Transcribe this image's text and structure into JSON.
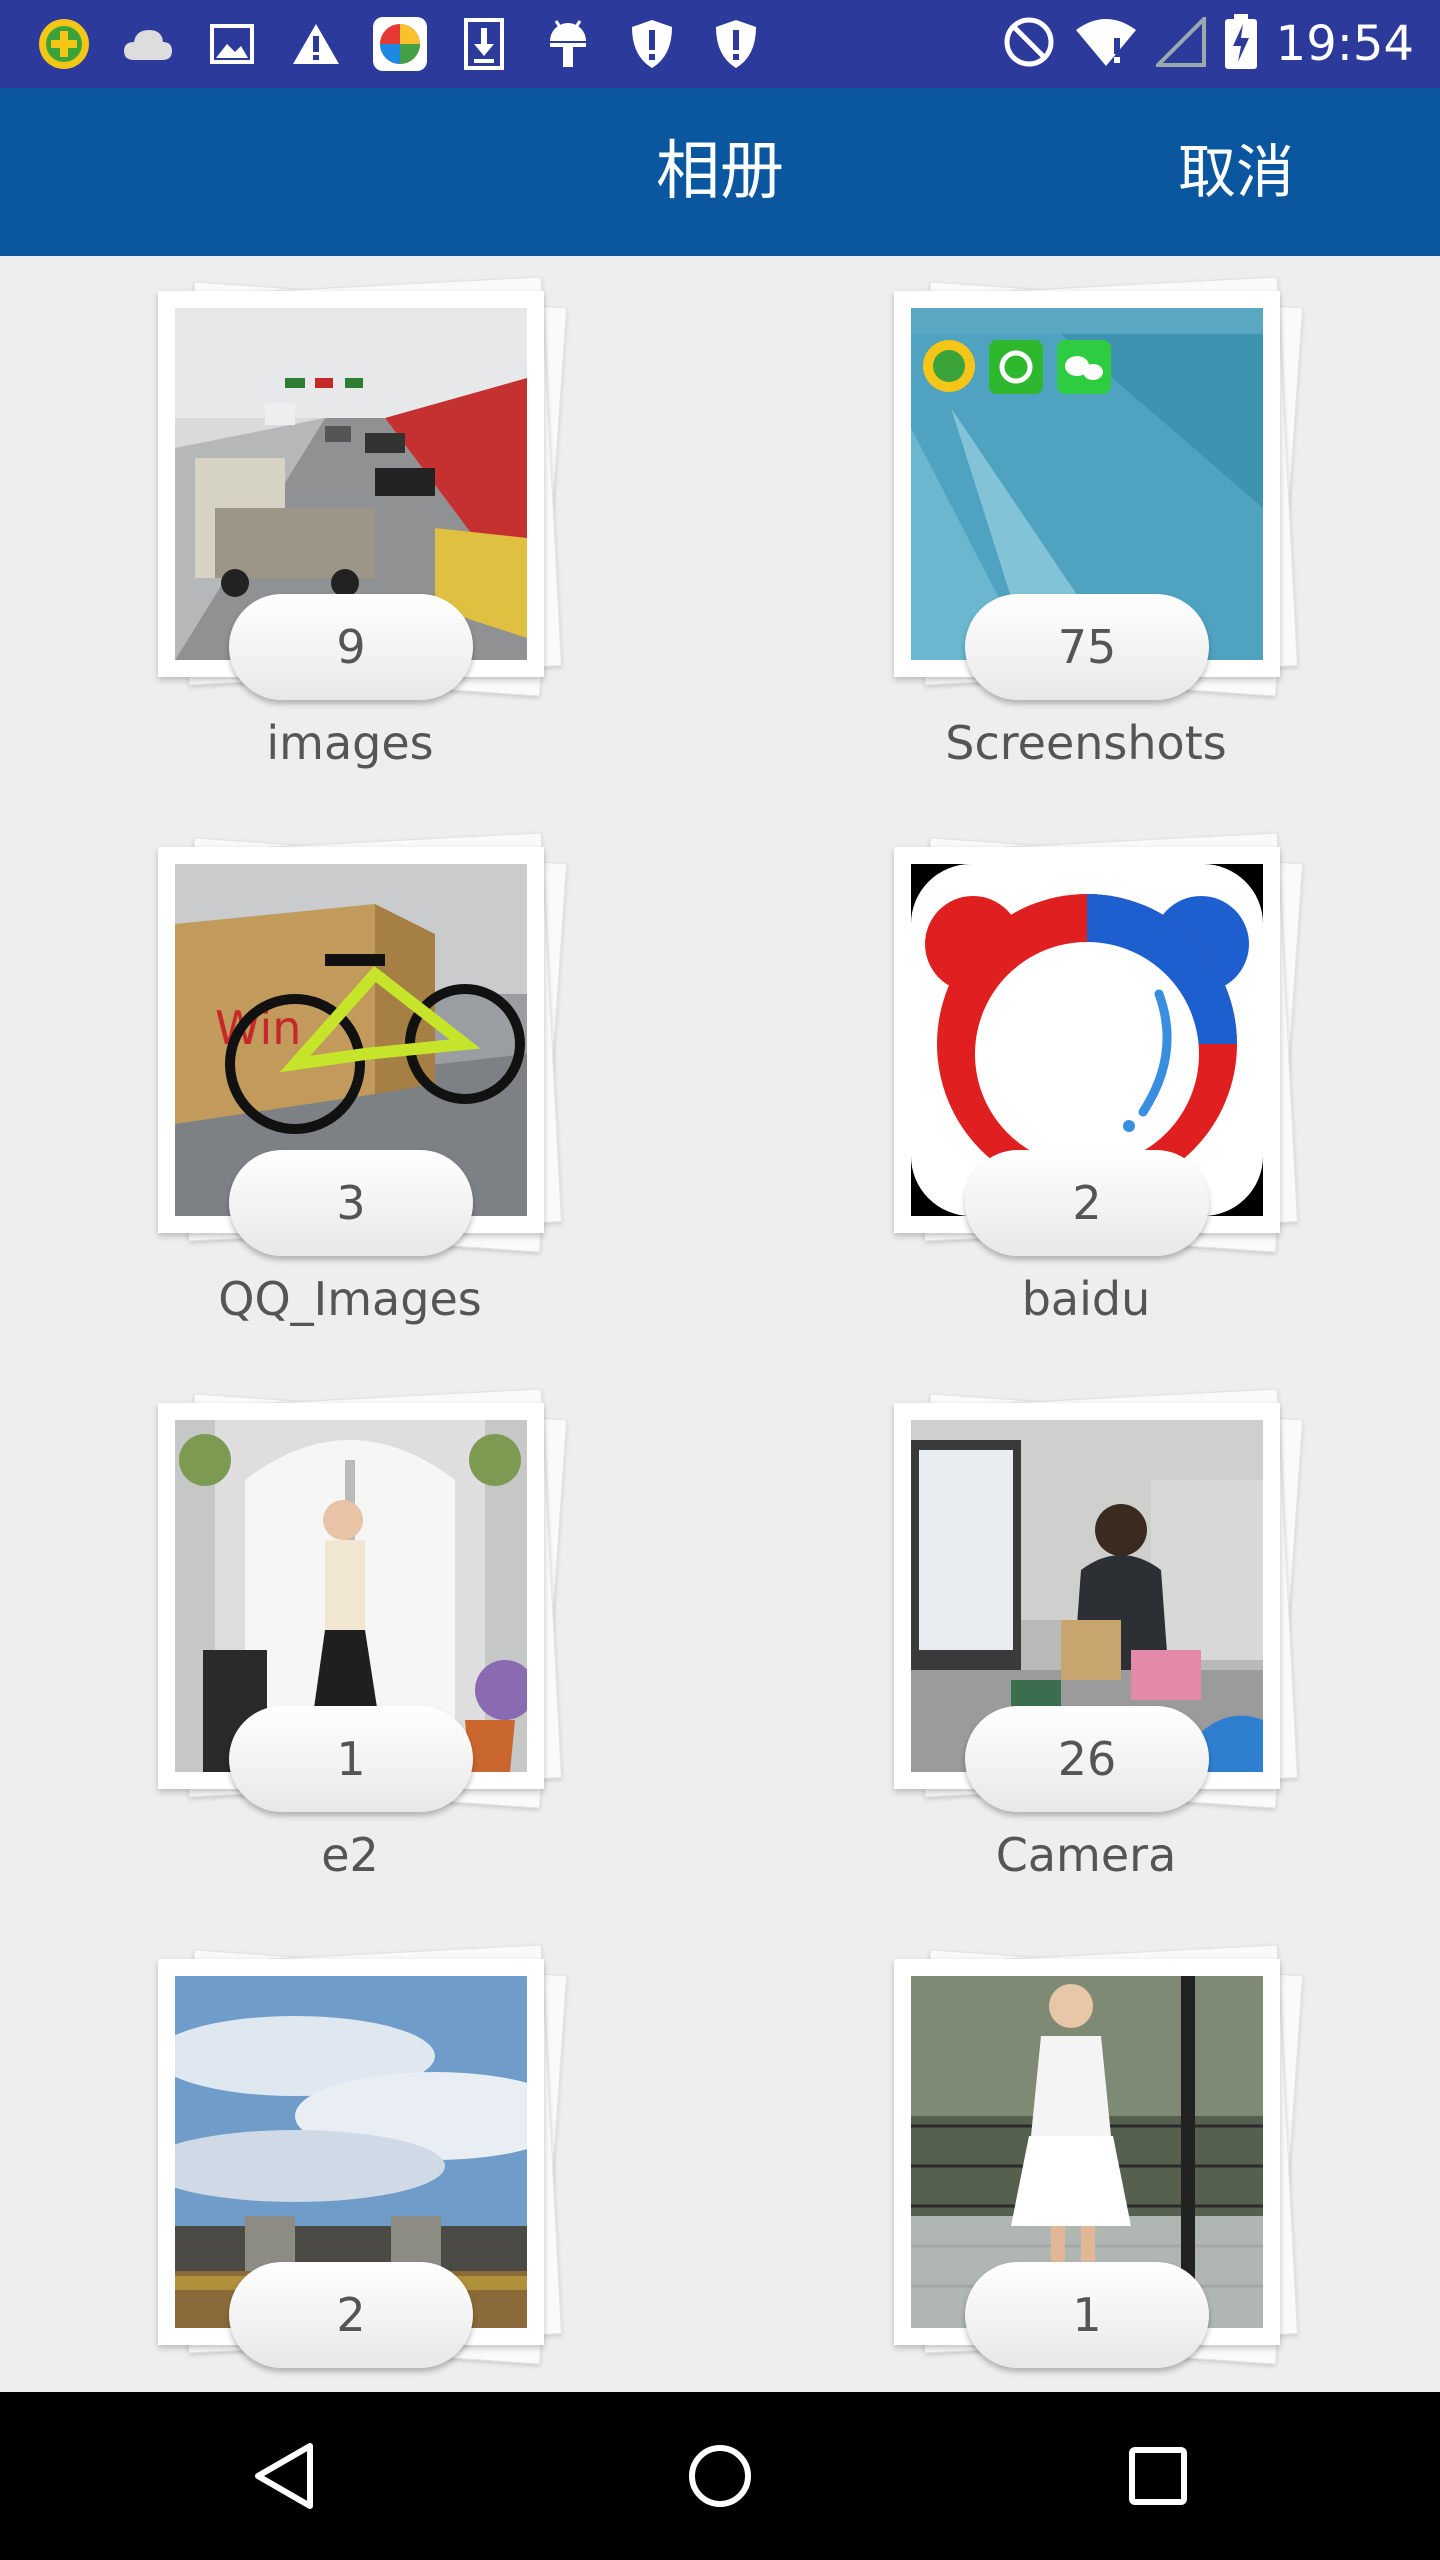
{
  "status_bar": {
    "time": "19:54",
    "left_icons": [
      "plus-app-icon",
      "cloud-icon",
      "image-icon",
      "warning-icon",
      "gallery-app-icon",
      "download-icon",
      "android-icon",
      "shield-icon",
      "shield-icon"
    ],
    "right_icons": [
      "no-disturb-icon",
      "wifi-icon",
      "signal-icon",
      "battery-charging-icon"
    ]
  },
  "app_bar": {
    "title": "相册",
    "cancel_label": "取消"
  },
  "albums": [
    {
      "name": "images",
      "count": "9"
    },
    {
      "name": "Screenshots",
      "count": "75"
    },
    {
      "name": "QQ_Images",
      "count": "3"
    },
    {
      "name": "baidu",
      "count": "2"
    },
    {
      "name": "e2",
      "count": "1"
    },
    {
      "name": "Camera",
      "count": "26"
    },
    {
      "name": "",
      "count": "2"
    },
    {
      "name": "",
      "count": "1"
    }
  ],
  "nav_bar": {
    "buttons": [
      "back-icon",
      "home-icon",
      "recents-icon"
    ]
  },
  "colors": {
    "status_bar": "#2c3a9b",
    "app_bar": "#0a57a0",
    "background": "#eeeeee",
    "nav_bar": "#000000"
  }
}
